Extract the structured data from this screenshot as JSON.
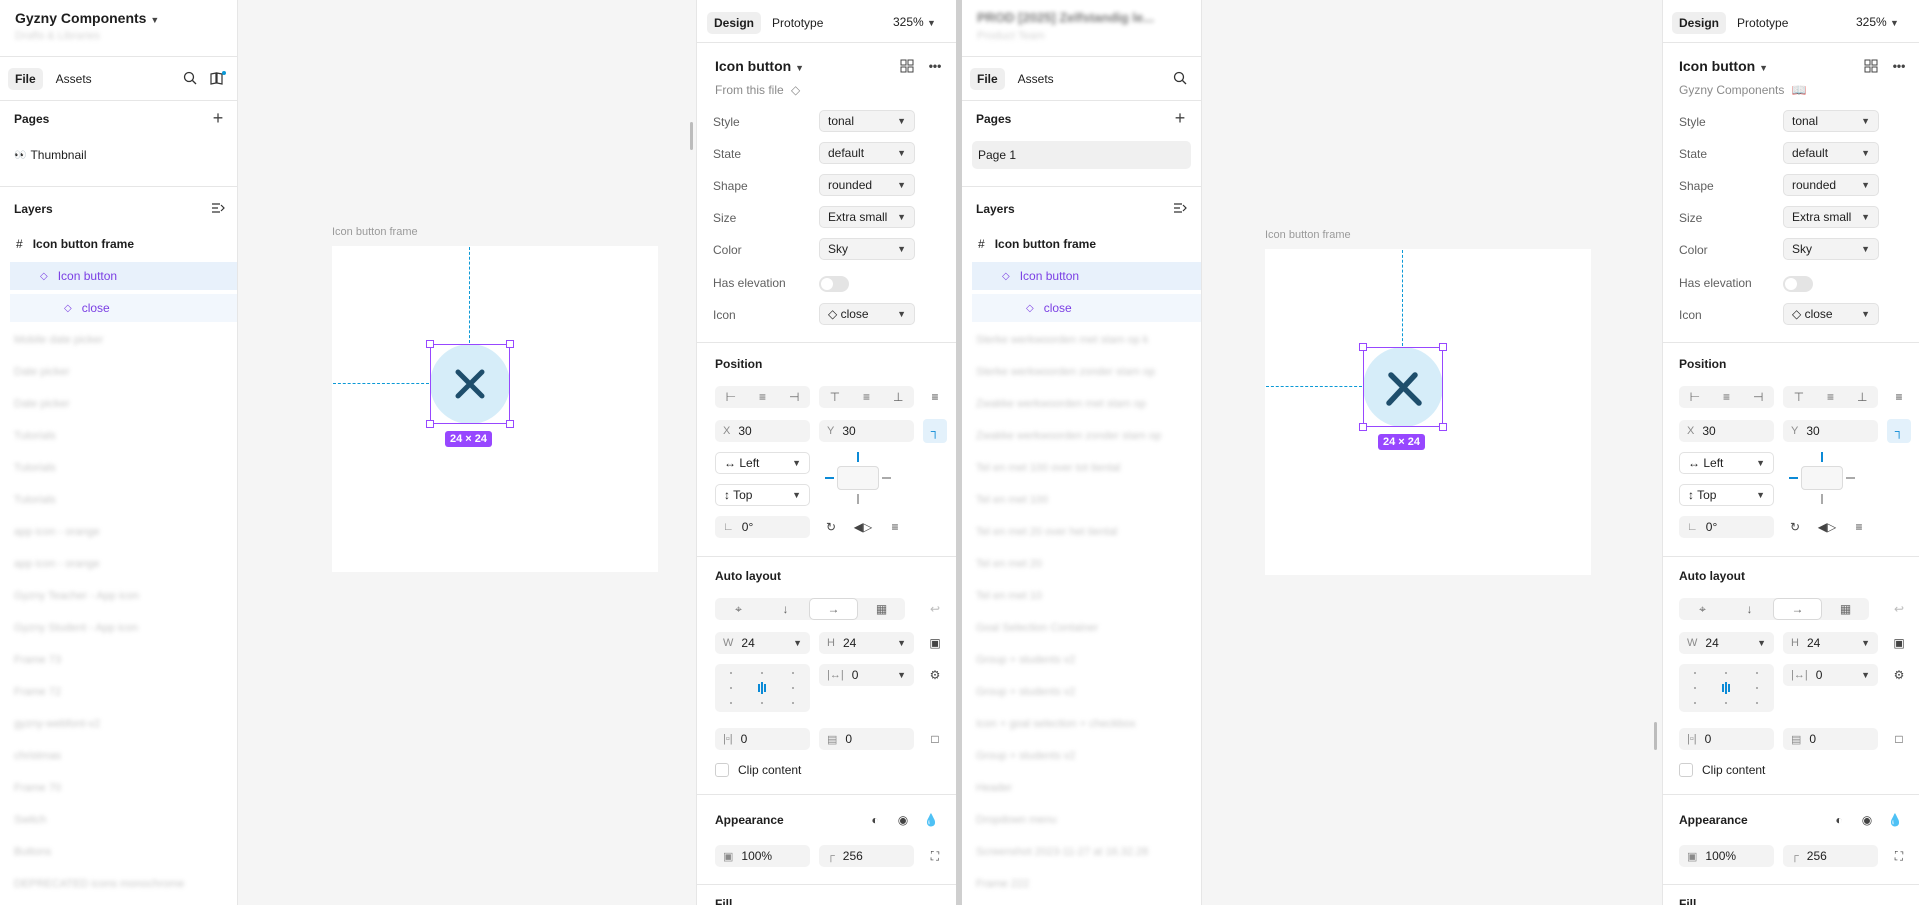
{
  "left_sidebar": {
    "title": "Gyzny Components",
    "subtitle": "Drafts & Libraries",
    "tabs": [
      "File",
      "Assets"
    ],
    "pages_title": "Pages",
    "pages": [
      {
        "emoji": "👀",
        "label": "Thumbnail"
      }
    ],
    "layers_title": "Layers",
    "layers": [
      {
        "label": "Icon button frame",
        "kind": "frame"
      },
      {
        "label": "Icon button",
        "kind": "component"
      },
      {
        "label": "close",
        "kind": "component"
      }
    ],
    "blurred_layers": [
      "Mobile date picker",
      "Date picker",
      "Date picker",
      "Tutorials",
      "Tutorials",
      "Tutorials",
      "app icon - orange",
      "app icon - orange",
      "Gyzny Teacher - App icon",
      "Gyzny Student - App icon",
      "Frame 73",
      "Frame 72",
      "gyzny-webfont-v2",
      "christmas",
      "Frame 70",
      "Switch",
      "Buttons",
      "DEPRECATED icons monochrome"
    ]
  },
  "canvas1": {
    "frame_label": "Icon button frame",
    "dim": "24 × 24"
  },
  "props1": {
    "tabs": [
      "Design",
      "Prototype"
    ],
    "zoom": "325%",
    "selection": "Icon button",
    "source_label": "From this file",
    "properties": [
      {
        "label": "Style",
        "value": "tonal"
      },
      {
        "label": "State",
        "value": "default"
      },
      {
        "label": "Shape",
        "value": "rounded"
      },
      {
        "label": "Size",
        "value": "Extra small"
      },
      {
        "label": "Color",
        "value": "Sky"
      }
    ],
    "elevation_label": "Has elevation",
    "icon_label": "Icon",
    "icon_value": "close",
    "position_title": "Position",
    "x_label": "X",
    "x": "30",
    "y_label": "Y",
    "y": "30",
    "h_constraint": "Left",
    "v_constraint": "Top",
    "rotation": "0°",
    "auto_layout_title": "Auto layout",
    "w_label": "W",
    "w": "24",
    "h_label": "H",
    "h": "24",
    "gap": "0",
    "pad_h": "0",
    "pad_v": "0",
    "clip_label": "Clip content",
    "appearance_title": "Appearance",
    "opacity": "100%",
    "radius": "256",
    "fill_title": "Fill"
  },
  "mid_sidebar": {
    "title": "PROD [2025] Zelfstandig le...",
    "subtitle": "Product Team",
    "tabs": [
      "File",
      "Assets"
    ],
    "pages_title": "Pages",
    "pages": [
      {
        "label": "Page 1"
      }
    ],
    "layers_title": "Layers",
    "layers": [
      {
        "label": "Icon button frame",
        "kind": "frame"
      },
      {
        "label": "Icon button",
        "kind": "component"
      },
      {
        "label": "close",
        "kind": "component"
      }
    ],
    "blurred_layers": [
      "Sterke werkwoorden met stam op k",
      "Sterke werkwoorden zonder stam op",
      "Zwakke werkwoorden met stam op",
      "Zwakke werkwoorden zonder stam op",
      "Tel en met 100 over tot tiental",
      "Tel en met 100",
      "Tel en met 20 over het tiental",
      "Tel en met 20",
      "Tel en met 10",
      "Goal Selection Container",
      "Group + students v2",
      "Group + students v2",
      "Icon + goal selection + checkbox",
      "Group + students v2",
      "Header",
      "Dropdown menu",
      "Screenshot 2023-11-27 at 16.32.28",
      "Frame 222"
    ]
  },
  "canvas2": {
    "frame_label": "Icon button frame",
    "dim": "24 × 24"
  },
  "props2": {
    "tabs": [
      "Design",
      "Prototype"
    ],
    "zoom": "325%",
    "selection": "Icon button",
    "source_label": "Gyzny Components",
    "properties": [
      {
        "label": "Style",
        "value": "tonal"
      },
      {
        "label": "State",
        "value": "default"
      },
      {
        "label": "Shape",
        "value": "rounded"
      },
      {
        "label": "Size",
        "value": "Extra small"
      },
      {
        "label": "Color",
        "value": "Sky"
      }
    ],
    "elevation_label": "Has elevation",
    "icon_label": "Icon",
    "icon_value": "close",
    "position_title": "Position",
    "x_label": "X",
    "x": "30",
    "y_label": "Y",
    "y": "30",
    "h_constraint": "Left",
    "v_constraint": "Top",
    "rotation": "0°",
    "auto_layout_title": "Auto layout",
    "w_label": "W",
    "w": "24",
    "h_label": "H",
    "h": "24",
    "gap": "0",
    "pad_h": "0",
    "pad_v": "0",
    "clip_label": "Clip content",
    "appearance_title": "Appearance",
    "opacity": "100%",
    "radius": "256",
    "fill_title": "Fill"
  },
  "colors": {
    "selection": "#9747ff",
    "guide": "#0b99d6",
    "icon_button_bg": "#d6edf9",
    "icon_glyph": "#1e4e6c",
    "layer_highlight": "#e8f1fb"
  }
}
